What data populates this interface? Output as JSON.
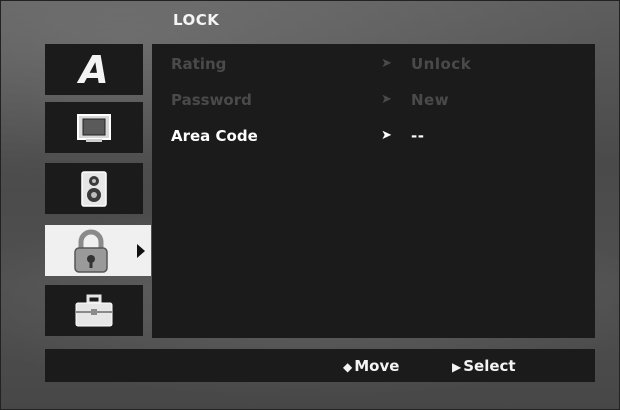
{
  "header": {
    "title": "LOCK"
  },
  "menu": {
    "rows": [
      {
        "label": "Rating",
        "arrow": "➤",
        "value": "Unlock"
      },
      {
        "label": "Password",
        "arrow": "➤",
        "value": "New"
      },
      {
        "label": "Area Code",
        "arrow": "➤",
        "value": "--"
      }
    ]
  },
  "tabs": [
    {
      "name": "language-tab",
      "icon": "letter-a-icon",
      "glyph": "A"
    },
    {
      "name": "display-tab",
      "icon": "tv-icon"
    },
    {
      "name": "audio-tab",
      "icon": "speaker-icon"
    },
    {
      "name": "lock-tab",
      "icon": "padlock-icon",
      "selected": true
    },
    {
      "name": "others-tab",
      "icon": "briefcase-icon"
    }
  ],
  "footer": {
    "move_icon": "◆",
    "move_label": "Move",
    "select_icon": "▶",
    "select_label": "Select"
  },
  "colors": {
    "panel": "#1b1b1b",
    "selected_tab": "#f0f0f0",
    "disabled_text": "#4a4a4a",
    "active_text": "#ffffff"
  }
}
